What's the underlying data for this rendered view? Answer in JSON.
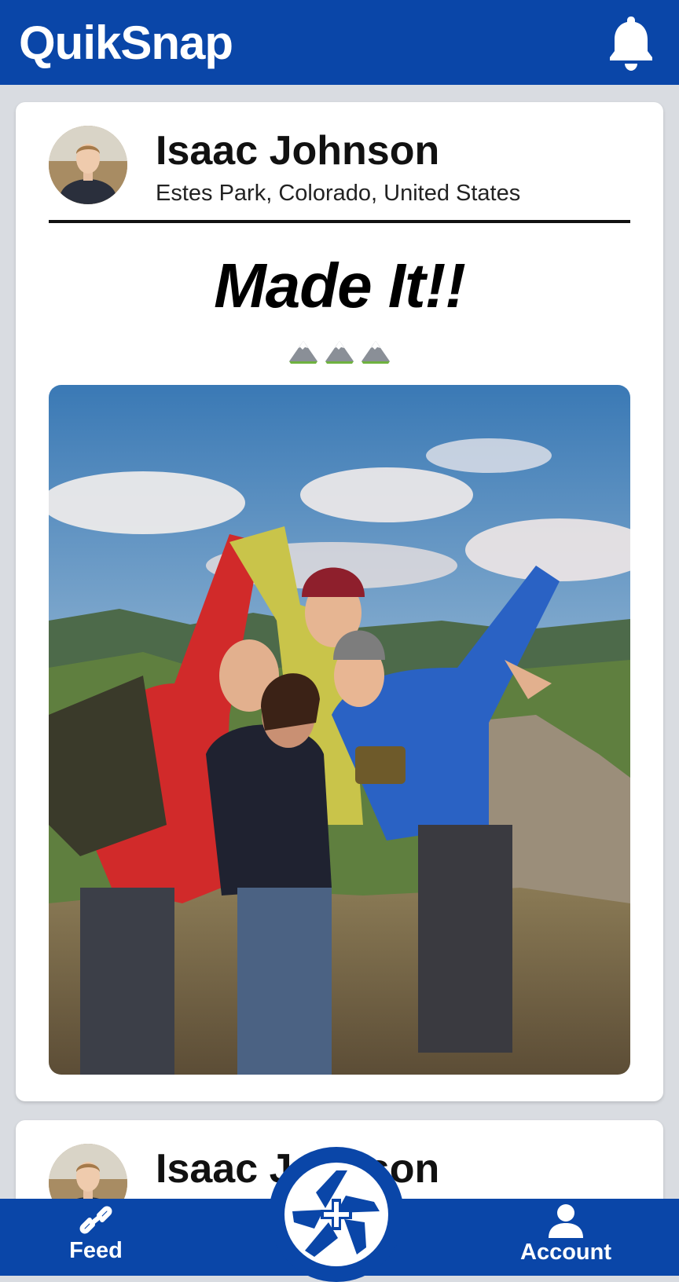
{
  "app": {
    "title": "QuikSnap"
  },
  "header": {
    "notification_icon": "bell-icon"
  },
  "posts": [
    {
      "user_name": "Isaac Johnson",
      "location": "Estes Park, Colorado, United States",
      "title": "Made It!!",
      "emoji": "mountain-emoji x3",
      "photo": "group-selfie-mountain-summit-photo"
    },
    {
      "user_name": "Isaac Johnson"
    }
  ],
  "nav": {
    "feed_label": "Feed",
    "feed_icon": "link-icon",
    "camera_icon": "camera-shutter-plus-icon",
    "account_label": "Account",
    "account_icon": "person-icon"
  },
  "colors": {
    "brand_blue": "#0a46a8",
    "background": "#d9dce1",
    "card": "#ffffff"
  }
}
